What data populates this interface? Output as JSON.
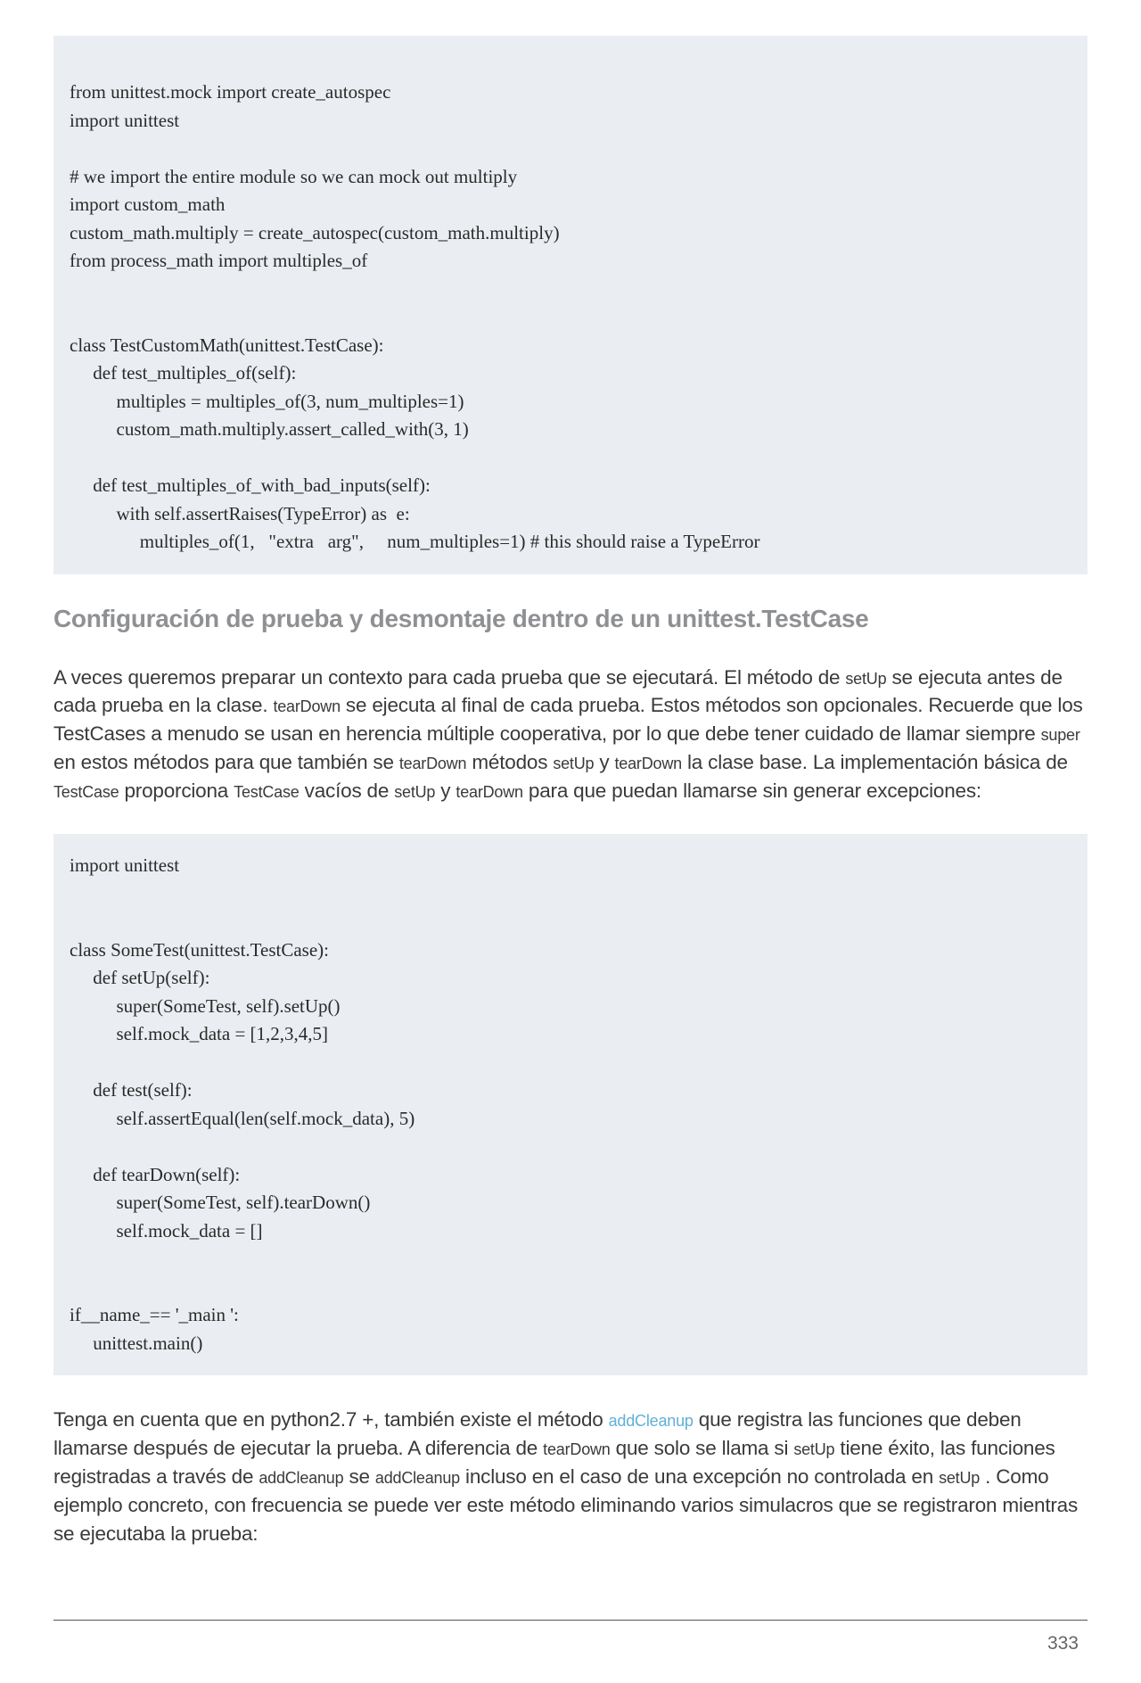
{
  "codeblock1": "from unittest.mock import create_autospec\nimport unittest\n\n# we import the entire module so we can mock out multiply\nimport custom_math\ncustom_math.multiply = create_autospec(custom_math.multiply)\nfrom process_math import multiples_of\n\n\nclass TestCustomMath(unittest.TestCase):\n     def test_multiples_of(self):\n          multiples = multiples_of(3, num_multiples=1)\n          custom_math.multiply.assert_called_with(3, 1)\n\n     def test_multiples_of_with_bad_inputs(self):\n          with self.assertRaises(TypeError) as  e:\n               multiples_of(1,   \"extra   arg\",     num_multiples=1) # this should raise a TypeError",
  "heading": "Configuración de prueba y desmontaje dentro de un unittest.TestCase",
  "paragraph1": {
    "seg1": "A veces queremos preparar un contexto para cada prueba que se ejecutará. El método de ",
    "c1": "setUp",
    "seg2": " se ejecuta antes de cada prueba en la clase. ",
    "c2": "tearDown",
    "seg3": " se ejecuta al final de cada prueba. Estos métodos son opcionales. Recuerde que los TestCases a menudo se usan en herencia múltiple cooperativa, por lo que debe tener cuidado de llamar siempre ",
    "c3": "super",
    "seg4": " en estos métodos para que también se ",
    "c4": "tearDown",
    "seg5": " métodos ",
    "c5": "setUp",
    "seg6": " y ",
    "c6": "tearDown",
    "seg7": " la clase base. La implementación básica de ",
    "c7": "TestCase",
    "seg8": " proporciona ",
    "c8": "TestCase",
    "seg9": " vacíos de ",
    "c9": "setUp",
    "seg10": " y ",
    "c10": "tearDown",
    "seg11": " para que puedan llamarse sin generar excepciones:"
  },
  "codeblock2": "import unittest\n\n\nclass SomeTest(unittest.TestCase):\n     def setUp(self):\n          super(SomeTest, self).setUp()\n          self.mock_data = [1,2,3,4,5]\n\n     def test(self):\n          self.assertEqual(len(self.mock_data), 5)\n\n     def tearDown(self):\n          super(SomeTest, self).tearDown()\n          self.mock_data = []\n\n\nif__name_== '_main ':\n     unittest.main()",
  "paragraph2": {
    "seg1": "Tenga en cuenta que en python2.7 +, también existe el método ",
    "c1": "addCleanup",
    "seg2": " que registra las funciones que deben llamarse después de ejecutar la prueba. A diferencia de ",
    "c2": "tearDown",
    "seg3": " que solo se llama si ",
    "c3": "setUp",
    "seg4": " tiene éxito, las funciones registradas a través de ",
    "c4": "addCleanup",
    "seg5": " se ",
    "c5": "addCleanup",
    "seg6": " incluso en el caso de una excepción no controlada en ",
    "c6": "setUp",
    "seg7": " . Como ejemplo concreto, con frecuencia se puede ver este método eliminando varios simulacros que se registraron mientras se ejecutaba la prueba:"
  },
  "pageNumber": "333"
}
